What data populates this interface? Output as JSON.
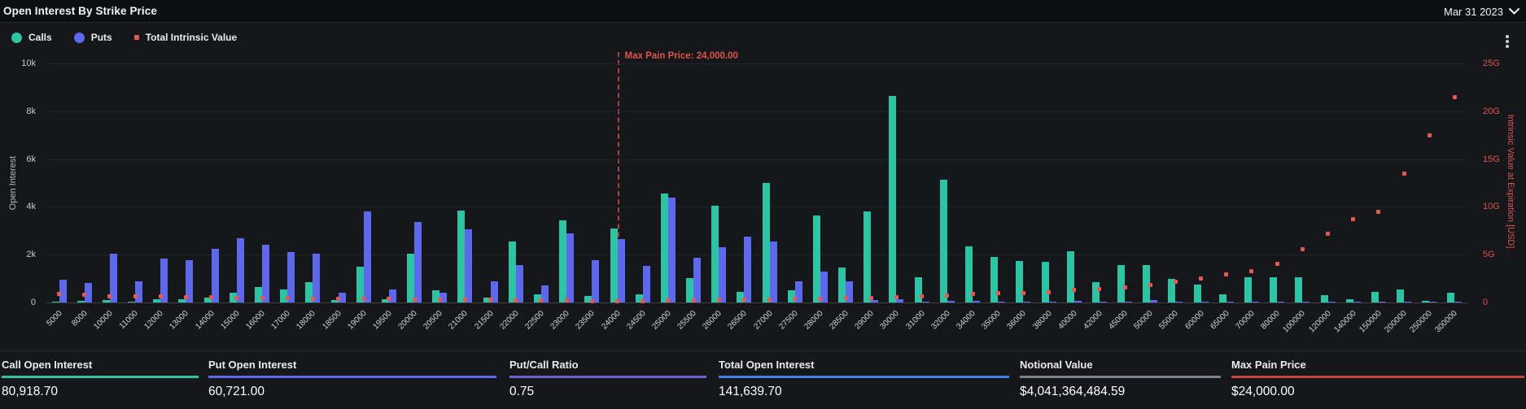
{
  "header": {
    "title": "Open Interest By Strike Price",
    "date_selector": "Mar 31 2023"
  },
  "legend": [
    {
      "label": "Calls",
      "color": "#2cc4a4",
      "shape": "circle"
    },
    {
      "label": "Puts",
      "color": "#5d68eb",
      "shape": "circle"
    },
    {
      "label": "Total Intrinsic Value",
      "color": "#e25a50",
      "shape": "square"
    }
  ],
  "colors": {
    "calls": "#2cc4a4",
    "puts": "#5d68eb",
    "intrinsic": "#e25a50",
    "right_axis_text": "#e0544b",
    "max_pain_line": "#c14e44"
  },
  "chart_data": {
    "type": "bar",
    "title": "Open Interest By Strike Price",
    "categories": [
      "5000",
      "8000",
      "10000",
      "11000",
      "12000",
      "13000",
      "14000",
      "15000",
      "16000",
      "17000",
      "18000",
      "18500",
      "19000",
      "19500",
      "20000",
      "20500",
      "21000",
      "21500",
      "22000",
      "22500",
      "23000",
      "23500",
      "24000",
      "24500",
      "25000",
      "25500",
      "26000",
      "26500",
      "27000",
      "27500",
      "28000",
      "28500",
      "29000",
      "30000",
      "31000",
      "32000",
      "34000",
      "35000",
      "36000",
      "38000",
      "40000",
      "42000",
      "45000",
      "50000",
      "55000",
      "60000",
      "65000",
      "70000",
      "80000",
      "100000",
      "120000",
      "140000",
      "150000",
      "200000",
      "250000",
      "300000"
    ],
    "series": [
      {
        "name": "Calls",
        "type": "bar",
        "axis": "left",
        "values": [
          50,
          60,
          100,
          50,
          120,
          150,
          200,
          400,
          650,
          550,
          850,
          100,
          1500,
          150,
          2050,
          500,
          3850,
          200,
          2550,
          350,
          3450,
          270,
          3100,
          330,
          4570,
          1030,
          4050,
          450,
          5000,
          500,
          3650,
          1450,
          3800,
          8650,
          1050,
          5150,
          2350,
          1900,
          1750,
          1700,
          2150,
          850,
          1550,
          1550,
          1000,
          750,
          350,
          1050,
          1050,
          1050,
          300,
          150,
          450,
          550,
          60,
          400
        ]
      },
      {
        "name": "Puts",
        "type": "bar",
        "axis": "left",
        "values": [
          950,
          800,
          2030,
          900,
          1830,
          1770,
          2230,
          2700,
          2430,
          2100,
          2050,
          400,
          3800,
          530,
          3380,
          420,
          3070,
          900,
          1560,
          700,
          2880,
          1770,
          2650,
          1540,
          4380,
          1860,
          2300,
          2770,
          2540,
          900,
          1300,
          900,
          110,
          150,
          30,
          60,
          60,
          30,
          30,
          30,
          80,
          20,
          30,
          110,
          30,
          20,
          10,
          30,
          30,
          30,
          10,
          10,
          10,
          20,
          10,
          10
        ]
      },
      {
        "name": "Total Intrinsic Value",
        "type": "scatter",
        "axis": "right",
        "values_G": [
          0.9,
          0.8,
          0.68,
          0.65,
          0.62,
          0.58,
          0.55,
          0.5,
          0.47,
          0.44,
          0.42,
          0.4,
          0.38,
          0.36,
          0.34,
          0.32,
          0.3,
          0.27,
          0.25,
          0.22,
          0.2,
          0.17,
          0.13,
          0.16,
          0.19,
          0.22,
          0.26,
          0.3,
          0.34,
          0.38,
          0.42,
          0.46,
          0.5,
          0.58,
          0.66,
          0.75,
          0.88,
          0.95,
          1.0,
          1.1,
          1.3,
          1.4,
          1.55,
          1.85,
          2.15,
          2.55,
          2.9,
          3.3,
          4.05,
          5.55,
          7.15,
          8.7,
          9.5,
          13.5,
          17.5,
          21.5
        ]
      }
    ],
    "ylabel_left": "Open Interest",
    "ylabel_right": "Intrinsic Value at Expiration [USD]",
    "ylim_left": [
      0,
      10000
    ],
    "ylim_right_G": [
      0,
      25
    ],
    "left_ticks": [
      "10k",
      "8k",
      "6k",
      "4k",
      "2k",
      "0"
    ],
    "right_ticks": [
      "25G",
      "20G",
      "15G",
      "10G",
      "5G",
      "0"
    ],
    "grid": true,
    "legend_position": "top-left",
    "annotation": {
      "label": "Max Pain Price: 24,000.00",
      "category": "24000",
      "category_index": 22
    }
  },
  "stats": [
    {
      "label": "Call Open Interest",
      "value": "80,918.70",
      "accent": "#2cc4a4"
    },
    {
      "label": "Put Open Interest",
      "value": "60,721.00",
      "accent": "#5d68eb"
    },
    {
      "label": "Put/Call Ratio",
      "value": "0.75",
      "accent": "#6c63d2"
    },
    {
      "label": "Total Open Interest",
      "value": "141,639.70",
      "accent": "#3f7fe8"
    },
    {
      "label": "Notional Value",
      "value": "$4,041,364,484.59",
      "accent": "#7b828a"
    },
    {
      "label": "Max Pain Price",
      "value": "$24,000.00",
      "accent": "#c9463e"
    }
  ]
}
